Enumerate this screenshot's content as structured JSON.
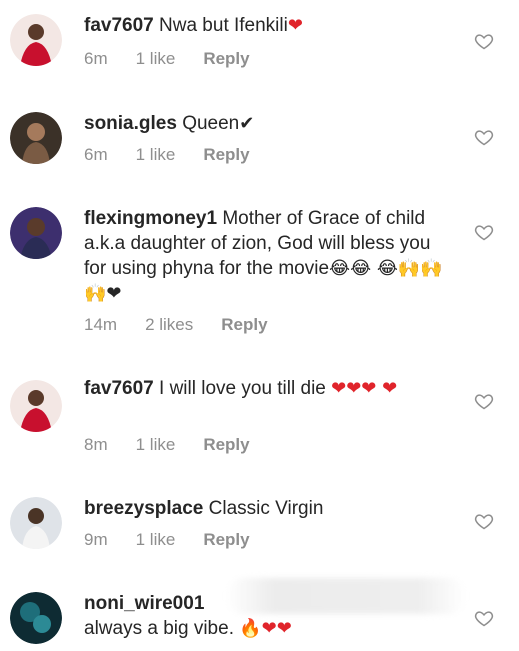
{
  "comments": [
    {
      "username": "fav7607",
      "text": "Nwa but Ifenkili",
      "emoji": "❤",
      "time": "6m",
      "likes": "1 like",
      "reply": "Reply"
    },
    {
      "username": "sonia.gles",
      "text": "Queen",
      "emoji": "✔",
      "time": "6m",
      "likes": "1 like",
      "reply": "Reply"
    },
    {
      "username": "flexingmoney1",
      "text": "Mother of Grace of child a.k.a daughter of zion, God will bless you for using phyna for the movie",
      "emoji": "😂😂 😂🙌🙌🙌❤",
      "time": "14m",
      "likes": "2 likes",
      "reply": "Reply"
    },
    {
      "username": "fav7607",
      "text": "I will love you till die",
      "emoji": "❤❤❤ ❤",
      "time": "8m",
      "likes": "1 like",
      "reply": "Reply"
    },
    {
      "username": "breezysplace",
      "text": "Classic Virgin",
      "emoji": "",
      "time": "9m",
      "likes": "1 like",
      "reply": "Reply"
    },
    {
      "username": "noni_wire001",
      "text": "always a big vibe.",
      "emoji": "🔥❤❤",
      "time": "",
      "likes": "",
      "reply": ""
    }
  ],
  "icons": {
    "like": "heart-outline-icon"
  },
  "colors": {
    "text": "#262626",
    "meta": "#8e8e8e",
    "heart": "#e0242b"
  }
}
